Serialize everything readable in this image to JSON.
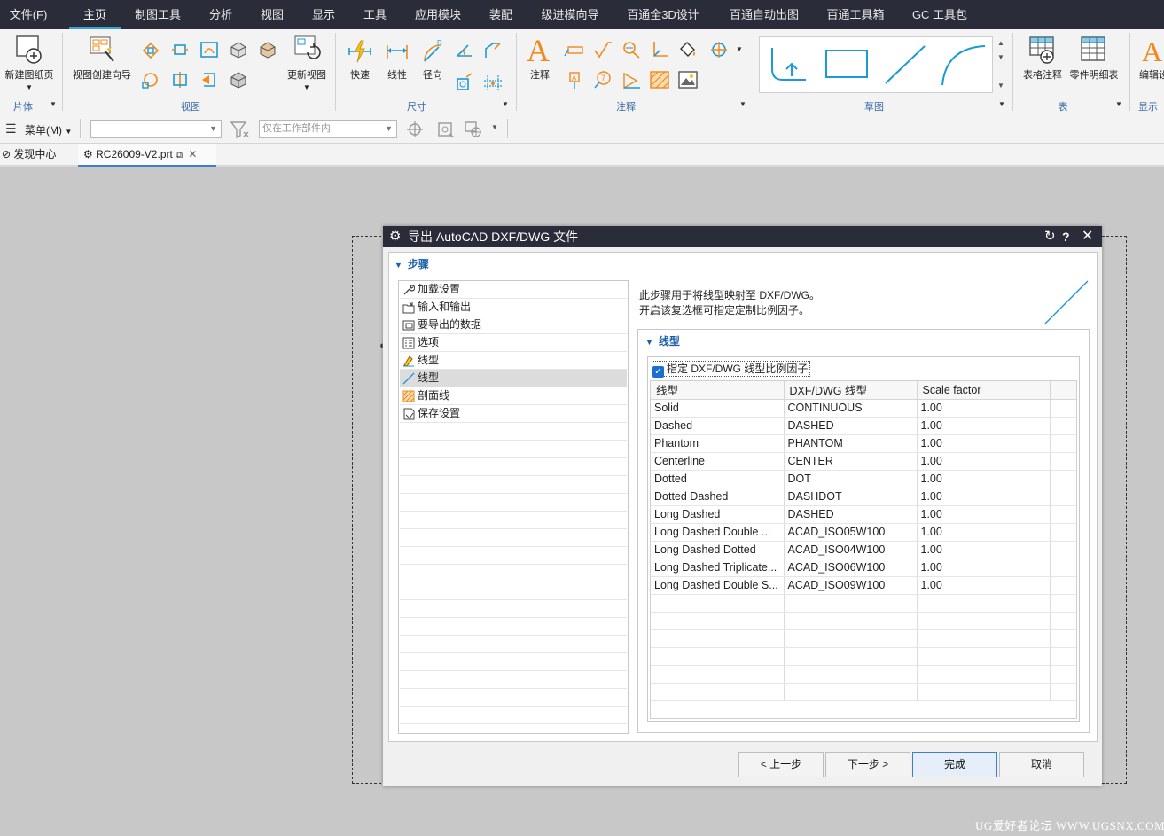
{
  "menubar": {
    "tabs": [
      "文件(F)",
      "主页",
      "制图工具",
      "分析",
      "视图",
      "显示",
      "工具",
      "应用模块",
      "装配",
      "级进模向导",
      "百通全3D设计",
      "百通自动出图",
      "百通工具箱",
      "GC 工具包"
    ],
    "active_tab": "主页"
  },
  "ribbon": {
    "new_sheet": "新建图纸页",
    "view_wizard": "视图创建向导",
    "update_view": "更新视图",
    "quick": "快速",
    "linear": "线性",
    "radial": "径向",
    "note": "注释",
    "table_note": "表格注释",
    "parts_list": "零件明细表",
    "edit_label": "编辑设",
    "groups": {
      "sheet": "片体",
      "view": "视图",
      "dimension": "尺寸",
      "annotation": "注释",
      "sketch": "草图",
      "table": "表",
      "display": "显示"
    }
  },
  "toolbar2": {
    "menu_label": "菜单(M)",
    "filter_value": "",
    "scope_placeholder": "仅在工作部件内"
  },
  "tabs": {
    "discovery": "发现中心",
    "file": "RC26009-V2.prt"
  },
  "dialog": {
    "title": "导出 AutoCAD DXF/DWG 文件",
    "steps_header": "步骤",
    "steps": [
      {
        "label": "加载设置",
        "icon": "wrench-icon"
      },
      {
        "label": "输入和输出",
        "icon": "folder-io-icon"
      },
      {
        "label": "要导出的数据",
        "icon": "data-icon"
      },
      {
        "label": "选项",
        "icon": "options-icon"
      },
      {
        "label": "线型",
        "icon": "linetype-pencil-icon"
      },
      {
        "label": "线型",
        "icon": "line-icon"
      },
      {
        "label": "剖面线",
        "icon": "hatch-icon"
      },
      {
        "label": "保存设置",
        "icon": "save-settings-icon"
      }
    ],
    "selected_step": 5,
    "description_line1": "此步骤用于将线型映射至 DXF/DWG。",
    "description_line2": "开启该复选框可指定定制比例因子。",
    "section_title": "线型",
    "checkbox_label": "指定 DXF/DWG 线型比例因子",
    "checkbox_checked": true,
    "table_headers": [
      "线型",
      "DXF/DWG 线型",
      "Scale factor"
    ],
    "table_rows": [
      [
        "Solid",
        "CONTINUOUS",
        "1.00"
      ],
      [
        "Dashed",
        "DASHED",
        "1.00"
      ],
      [
        "Phantom",
        "PHANTOM",
        "1.00"
      ],
      [
        "Centerline",
        "CENTER",
        "1.00"
      ],
      [
        "Dotted",
        "DOT",
        "1.00"
      ],
      [
        "Dotted Dashed",
        "DASHDOT",
        "1.00"
      ],
      [
        "Long Dashed",
        "DASHED",
        "1.00"
      ],
      [
        "Long Dashed Double ...",
        "ACAD_ISO05W100",
        "1.00"
      ],
      [
        "Long Dashed Dotted",
        "ACAD_ISO04W100",
        "1.00"
      ],
      [
        "Long Dashed Triplicate...",
        "ACAD_ISO06W100",
        "1.00"
      ],
      [
        "Long Dashed Double S...",
        "ACAD_ISO09W100",
        "1.00"
      ]
    ],
    "buttons": {
      "back": "< 上一步",
      "next": "下一步 >",
      "finish": "完成",
      "cancel": "取消"
    }
  },
  "watermark": "UG爱好者论坛 WWW.UGSNX.COM",
  "colors": {
    "accent_orange": "#f08a1c",
    "accent_blue": "#1a9ad6",
    "title_bar": "#2b2c3a",
    "link_blue": "#1a5fa8"
  }
}
